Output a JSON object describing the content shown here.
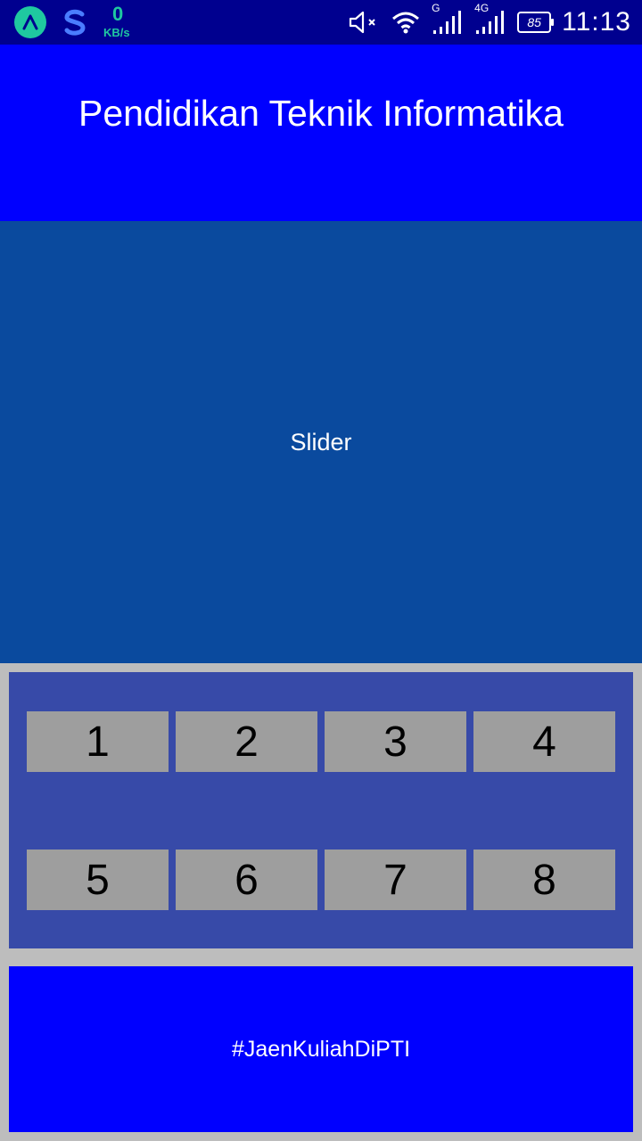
{
  "status_bar": {
    "net_speed_value": "0",
    "net_speed_unit": "KB/s",
    "sim1_type": "G",
    "sim2_type": "4G",
    "battery_level": "85",
    "time": "11:13",
    "icons": [
      "app-a-icon",
      "app-s-icon",
      "mute-icon",
      "wifi-icon",
      "signal-icon",
      "battery-icon"
    ]
  },
  "header": {
    "title": "Pendidikan Teknik Informatika"
  },
  "slider": {
    "label": "Slider"
  },
  "grid": {
    "items": [
      {
        "label": "1"
      },
      {
        "label": "2"
      },
      {
        "label": "3"
      },
      {
        "label": "4"
      },
      {
        "label": "5"
      },
      {
        "label": "6"
      },
      {
        "label": "7"
      },
      {
        "label": "8"
      }
    ]
  },
  "footer": {
    "text": "#JaenKuliahDiPTI"
  },
  "colors": {
    "status_bar": "#00008f",
    "header": "#0000ff",
    "slider": "#0a4a9e",
    "grid_panel": "#374aa8",
    "tile": "#9e9e9e",
    "background": "#bdbdbd"
  }
}
